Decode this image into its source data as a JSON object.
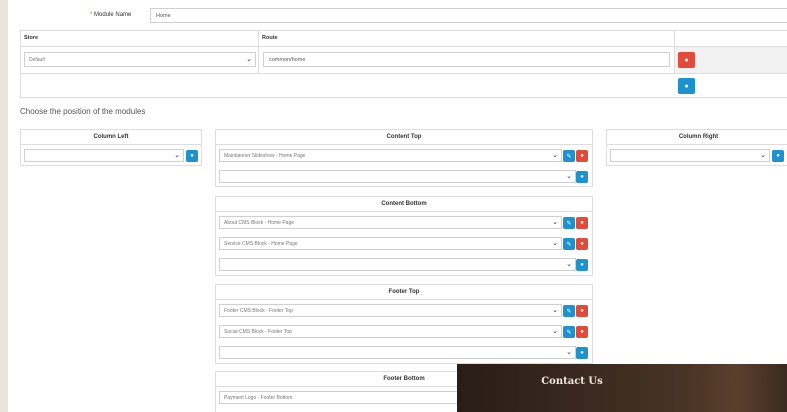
{
  "module": {
    "label": "Module Name",
    "required_mark": "*",
    "value": "Home"
  },
  "route_table": {
    "headers": {
      "store": "Store",
      "route": "Route"
    },
    "row": {
      "store": "Default",
      "route": "common/home"
    }
  },
  "positions_title": "Choose the position of the modules",
  "column_left": {
    "title": "Column Left"
  },
  "column_right": {
    "title": "Column Right"
  },
  "content_top": {
    "title": "Content Top",
    "items": [
      "Mainbanner Slideshow - Home Page"
    ]
  },
  "content_bottom": {
    "title": "Content Bottom",
    "items": [
      "About CMS Block - Home Page",
      "Service CMS Block - Home Page"
    ]
  },
  "footer_top": {
    "title": "Footer Top",
    "items": [
      "Footer CMS Block - Footer Top",
      "Social CMS Block - Footer Top"
    ]
  },
  "footer_bottom": {
    "title": "Footer Bottom",
    "items": [
      "Payment Logo - Footer Bottom"
    ]
  },
  "overlay": {
    "title": "Contact Us"
  },
  "colors": {
    "blue": "#1e91cf",
    "red": "#e04b3a",
    "page_bg": "#e8e4dc"
  },
  "icons": {
    "add": "plus-circle-icon",
    "remove": "minus-circle-icon",
    "edit": "pencil-icon",
    "dropdown": "chevron-down-icon"
  }
}
